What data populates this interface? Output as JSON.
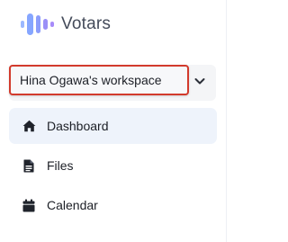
{
  "brand": {
    "name": "Votars",
    "logo_icon": "votars-waveform-logo",
    "logo_colors": [
      "#8fb0ff",
      "#a78bfa"
    ]
  },
  "workspace": {
    "name": "Hina Ogawa's workspace",
    "chevron_icon": "chevron-down-icon",
    "highlight_color": "#d23a2c"
  },
  "nav": {
    "items": [
      {
        "label": "Dashboard",
        "icon": "home-icon",
        "active": true
      },
      {
        "label": "Files",
        "icon": "file-icon",
        "active": false
      },
      {
        "label": "Calendar",
        "icon": "calendar-icon",
        "active": false
      }
    ],
    "active_bg": "#eef3fb"
  }
}
